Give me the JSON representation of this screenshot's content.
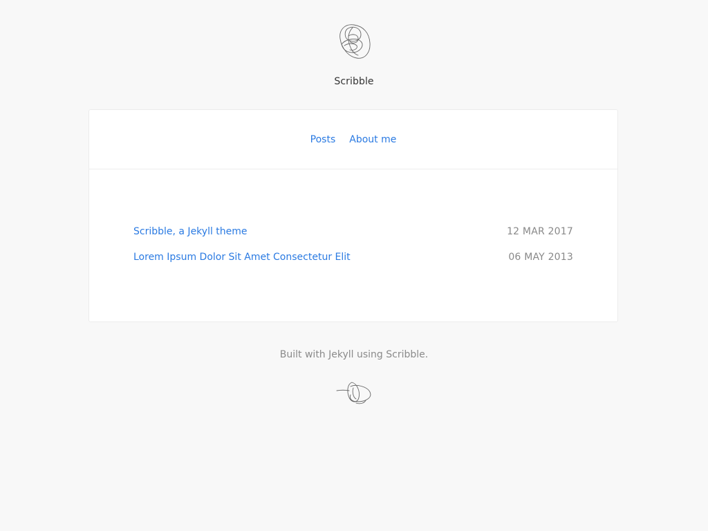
{
  "header": {
    "logo_icon": "scribble-logo-icon",
    "site_title": "Scribble"
  },
  "nav": {
    "items": [
      {
        "label": "Posts"
      },
      {
        "label": "About me"
      }
    ]
  },
  "posts": [
    {
      "title": "Scribble, a Jekyll theme",
      "date": "12 MAR 2017"
    },
    {
      "title": "Lorem Ipsum Dolor Sit Amet Consectetur Elit",
      "date": "06 MAY 2013"
    }
  ],
  "footer": {
    "text": "Built with Jekyll using Scribble.",
    "logo_icon": "scribble-signature-icon"
  },
  "colors": {
    "background": "#f8f8f8",
    "card": "#ffffff",
    "link": "#2a7ae2",
    "muted": "#888888",
    "title": "#333333"
  }
}
